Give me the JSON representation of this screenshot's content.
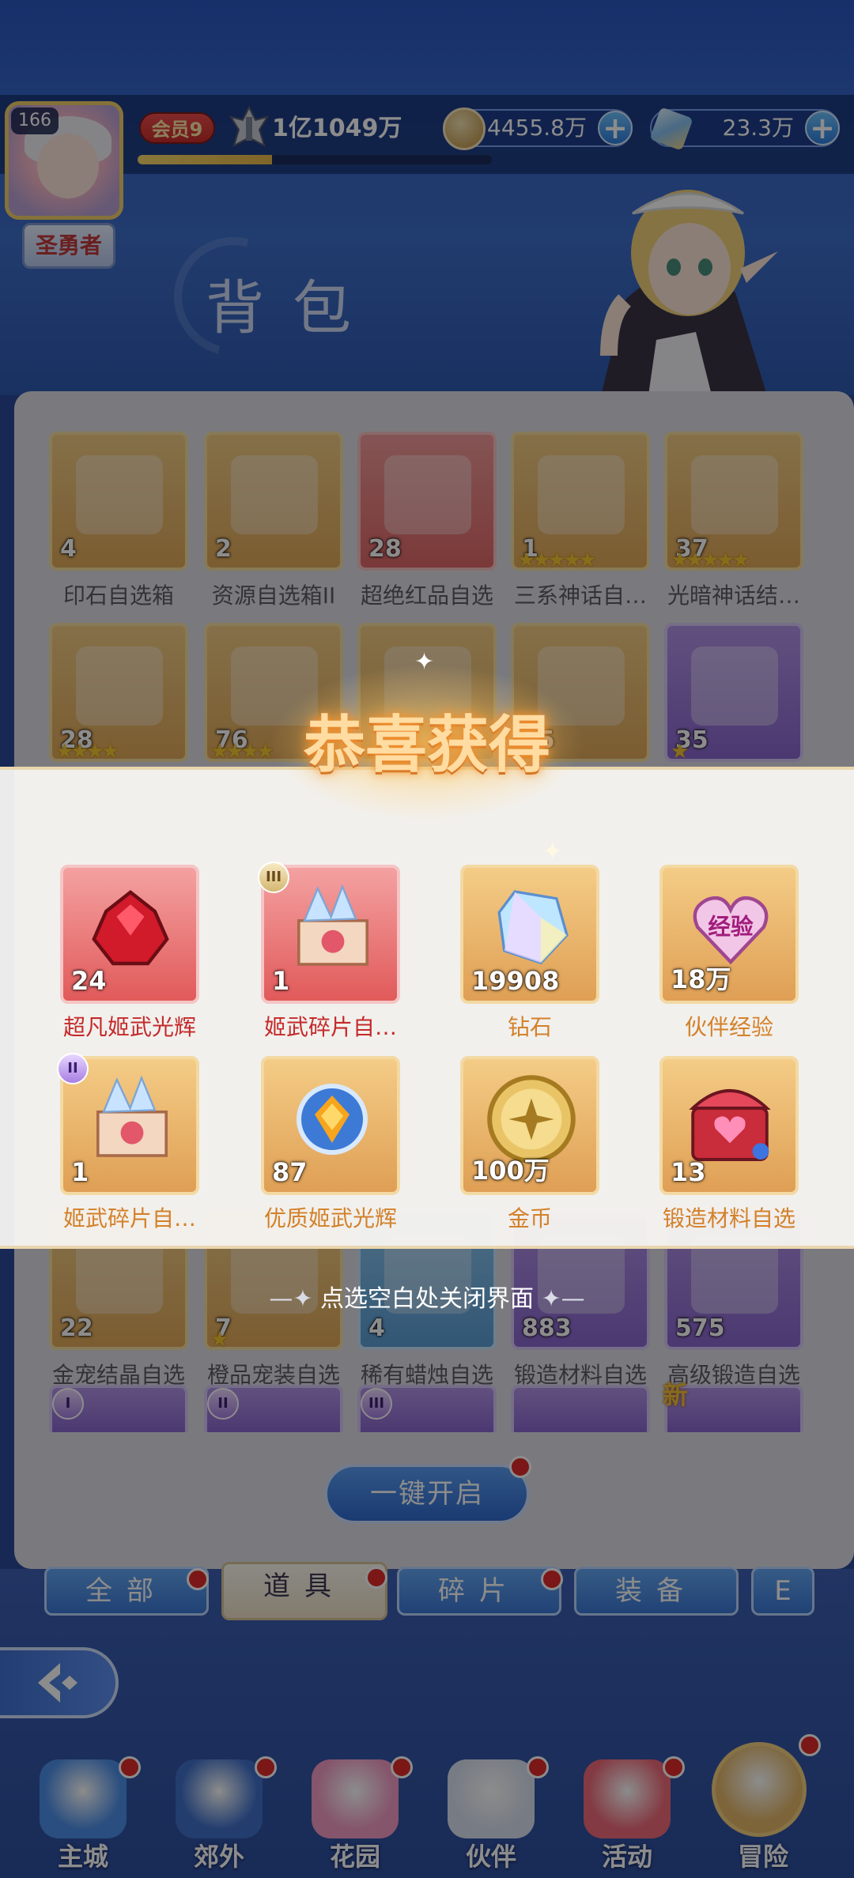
{
  "player": {
    "level": "166",
    "title": "圣勇者",
    "vip": "会员9",
    "power": "1亿1049万",
    "xp_progress": 0.38
  },
  "resources": {
    "gold": "4455.8万",
    "gems": "23.3万"
  },
  "page_title": "背包",
  "bag_items": [
    {
      "count": "4",
      "label": "印石自选箱",
      "color": "gold",
      "stars": ""
    },
    {
      "count": "2",
      "label": "资源自选箱II",
      "color": "gold",
      "stars": ""
    },
    {
      "count": "28",
      "label": "超绝红品自选",
      "color": "red",
      "stars": ""
    },
    {
      "count": "1",
      "label": "三系神话自…",
      "color": "gold",
      "stars": "★★★★★"
    },
    {
      "count": "37",
      "label": "光暗神话结…",
      "color": "gold",
      "stars": "★★★★★"
    },
    {
      "count": "28",
      "label": "",
      "color": "gold",
      "stars": "★★★★"
    },
    {
      "count": "76",
      "label": "",
      "color": "gold",
      "stars": "★★★★"
    },
    {
      "count": "",
      "label": "",
      "color": "gold",
      "stars": ""
    },
    {
      "count": "35",
      "label": "",
      "color": "gold",
      "stars": ""
    },
    {
      "count": "35",
      "label": "",
      "color": "purple",
      "stars": "★"
    },
    {
      "count": "22",
      "label": "金宠结晶自选",
      "color": "gold",
      "stars": ""
    },
    {
      "count": "7",
      "label": "橙品宠装自选",
      "color": "gold",
      "stars": "★"
    },
    {
      "count": "4",
      "label": "稀有蜡烛自选",
      "color": "blue",
      "stars": ""
    },
    {
      "count": "883",
      "label": "锻造材料自选",
      "color": "purple",
      "stars": ""
    },
    {
      "count": "575",
      "label": "高级锻造自选",
      "color": "purple",
      "stars": ""
    }
  ],
  "popup": {
    "title": "恭喜获得",
    "close_hint": "点选空白处关闭界面",
    "rewards": [
      {
        "count": "24",
        "label": "超凡姬武光辉",
        "bg": "red",
        "rarity": "rare",
        "icon": "red-gem-icon",
        "tier": ""
      },
      {
        "count": "1",
        "label": "姬武碎片自…",
        "bg": "red",
        "rarity": "rare",
        "icon": "fragment-box-icon",
        "tier": "III"
      },
      {
        "count": "19908",
        "label": "钻石",
        "bg": "gold",
        "rarity": "common",
        "icon": "diamond-icon",
        "tier": ""
      },
      {
        "count": "18万",
        "label": "伙伴经验",
        "bg": "gold",
        "rarity": "common",
        "icon": "exp-heart-icon",
        "tier": ""
      },
      {
        "count": "1",
        "label": "姬武碎片自…",
        "bg": "gold",
        "rarity": "common",
        "icon": "fragment-box-icon",
        "tier": "II"
      },
      {
        "count": "87",
        "label": "优质姬武光辉",
        "bg": "gold",
        "rarity": "common",
        "icon": "orange-gem-icon",
        "tier": ""
      },
      {
        "count": "100万",
        "label": "金币",
        "bg": "gold",
        "rarity": "common",
        "icon": "gold-coin-icon",
        "tier": ""
      },
      {
        "count": "13",
        "label": "锻造材料自选",
        "bg": "gold",
        "rarity": "common",
        "icon": "forge-chest-icon",
        "tier": ""
      }
    ],
    "exp_badge": "经验"
  },
  "open_all_label": "一键开启",
  "tabs": [
    "全部",
    "道具",
    "碎片",
    "装备"
  ],
  "nav": [
    "主城",
    "郊外",
    "花园",
    "伙伴",
    "活动",
    "冒险"
  ],
  "new_badge": "新",
  "colors": {
    "accent": "#3b78d6",
    "rare_text": "#c42a2a",
    "common_text": "#d3812a",
    "badge_red": "#e02a2a"
  }
}
